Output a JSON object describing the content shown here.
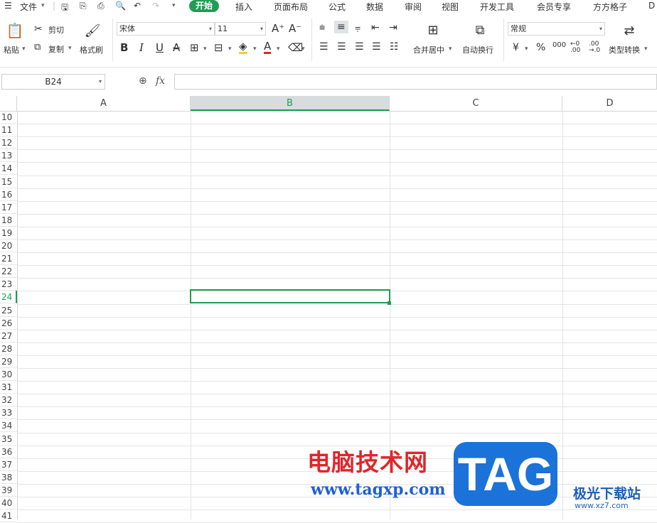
{
  "menubar": {
    "file": "文件",
    "tabs": [
      "开始",
      "插入",
      "页面布局",
      "公式",
      "数据",
      "审阅",
      "视图",
      "开发工具",
      "会员专享",
      "方方格子",
      "D"
    ]
  },
  "ribbon": {
    "paste": "粘贴",
    "cut": "剪切",
    "copy": "复制",
    "format_painter": "格式刷",
    "font_name": "宋体",
    "font_size": "11",
    "merge_center": "合并居中",
    "wrap_text": "自动换行",
    "number_format": "常规",
    "type_convert": "类型转换",
    "percent": "%",
    "thousands": "000"
  },
  "formula_bar": {
    "name_box": "B24",
    "fx": "fx",
    "value": ""
  },
  "grid": {
    "columns": [
      "A",
      "B",
      "C",
      "D"
    ],
    "active_column": "B",
    "rows": [
      "10",
      "11",
      "12",
      "13",
      "14",
      "15",
      "16",
      "17",
      "18",
      "19",
      "20",
      "21",
      "22",
      "23",
      "24",
      "25",
      "26",
      "27",
      "28",
      "29",
      "30",
      "31",
      "32",
      "33",
      "34",
      "35",
      "36",
      "37",
      "38",
      "39",
      "40",
      "41"
    ],
    "active_row": "24",
    "accent_color": "#1f9d55"
  },
  "watermark": {
    "site_cn": "电脑技术网",
    "site_url": "www.tagxp.com",
    "logo": "TAG",
    "brand2_cn": "极光下载站",
    "brand2_url": "www.xz7.com"
  }
}
